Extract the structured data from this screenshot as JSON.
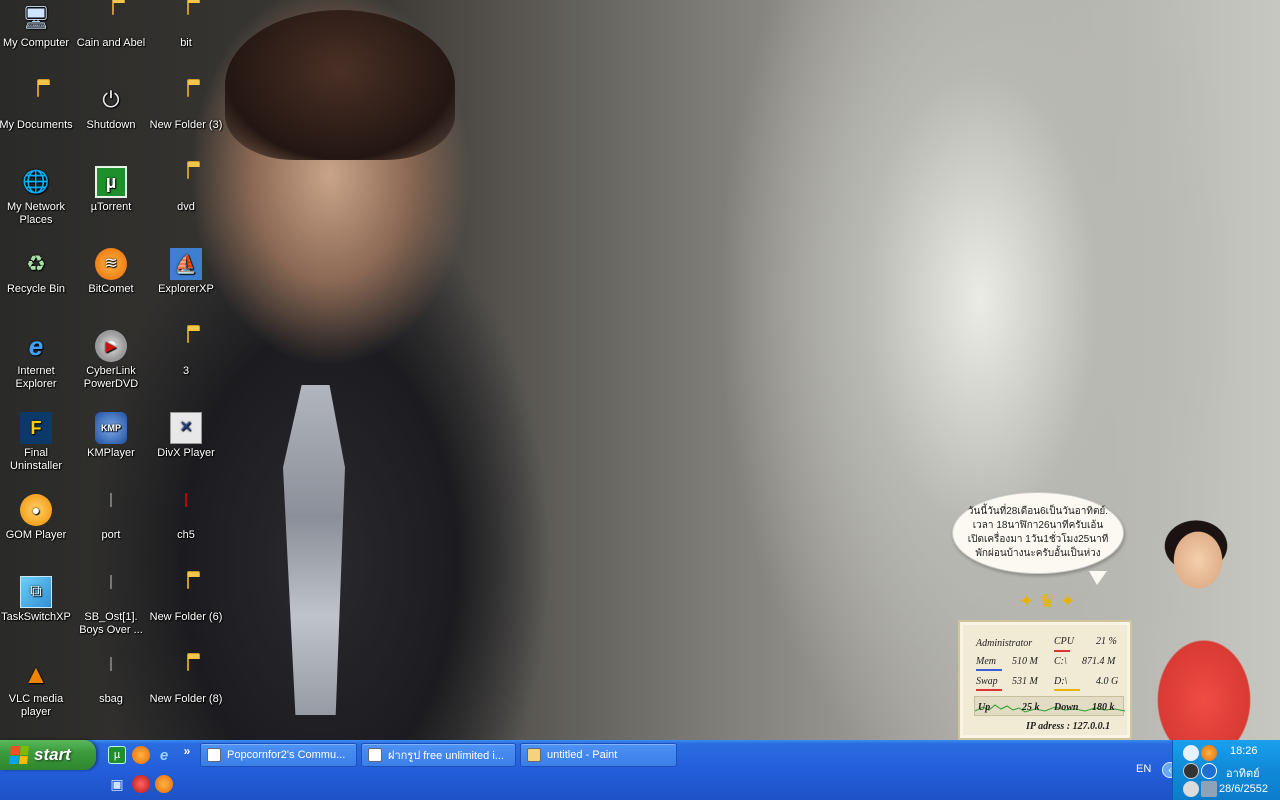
{
  "desktop": {
    "icons": [
      {
        "label": "My Computer",
        "icon": "computer-icon"
      },
      {
        "label": "Cain and Abel",
        "icon": "folder-icon"
      },
      {
        "label": "bit",
        "icon": "folder-icon"
      },
      {
        "label": "My Documents",
        "icon": "documents-icon"
      },
      {
        "label": "Shutdown",
        "icon": "shutdown-icon"
      },
      {
        "label": "New Folder (3)",
        "icon": "folder-icon"
      },
      {
        "label": "My Network Places",
        "icon": "network-icon"
      },
      {
        "label": "µTorrent",
        "icon": "utorrent-icon"
      },
      {
        "label": "dvd",
        "icon": "folder-icon"
      },
      {
        "label": "Recycle Bin",
        "icon": "recycle-bin-icon"
      },
      {
        "label": "BitComet",
        "icon": "bitcomet-icon"
      },
      {
        "label": "ExplorerXP",
        "icon": "explorerxp-icon"
      },
      {
        "label": "Internet Explorer",
        "icon": "ie-icon"
      },
      {
        "label": "CyberLink PowerDVD",
        "icon": "powerdvd-icon"
      },
      {
        "label": "3",
        "icon": "folder-icon"
      },
      {
        "label": "Final Uninstaller",
        "icon": "uninstaller-icon"
      },
      {
        "label": "KMPlayer",
        "icon": "kmplayer-icon"
      },
      {
        "label": "DivX Player",
        "icon": "divx-icon"
      },
      {
        "label": "GOM Player",
        "icon": "gom-icon"
      },
      {
        "label": "port",
        "icon": "text-file-icon"
      },
      {
        "label": "ch5",
        "icon": "pdf-file-icon"
      },
      {
        "label": "TaskSwitchXP",
        "icon": "taskswitch-icon"
      },
      {
        "label": "SB_Ost[1]. Boys Over ...",
        "icon": "text-file-icon"
      },
      {
        "label": "New Folder (6)",
        "icon": "folder-icon"
      },
      {
        "label": "VLC media player",
        "icon": "vlc-icon"
      },
      {
        "label": "sbag",
        "icon": "text-file-icon"
      },
      {
        "label": "New Folder (8)",
        "icon": "folder-icon"
      }
    ]
  },
  "widget": {
    "speech": "วันนี้วันที่28เดือน6เป็นวันอาทิตย์. เวลา 18นาฬิกา26นาทีครับเอ้น เปิดเครื่องมา 1วัน1ชั่วโมง25นาที พักผ่อนบ้างนะครับอั้นเป็นห่วง",
    "user": "Administrator",
    "cpu_label": "CPU",
    "cpu_value": "21 %",
    "mem_label": "Mem",
    "mem_value": "510 M",
    "c_label": "C:\\",
    "c_value": "871.4 M",
    "swap_label": "Swap",
    "swap_value": "531 M",
    "d_label": "D:\\",
    "d_value": "4.0 G",
    "up_label": "Up",
    "up_value": "25 k",
    "down_label": "Down",
    "down_value": "180 k",
    "ip": "IP adress : 127.0.0.1"
  },
  "taskbar": {
    "start_label": "start",
    "expand_glyph": "»",
    "tasks": [
      {
        "label": "Popcornfor2's Commu..."
      },
      {
        "label": "ฝากรูป free unlimited i..."
      },
      {
        "label": "untitled - Paint"
      }
    ],
    "language": "EN",
    "time": "18:26",
    "day": "อาทิตย์",
    "date": "28/6/2552"
  }
}
